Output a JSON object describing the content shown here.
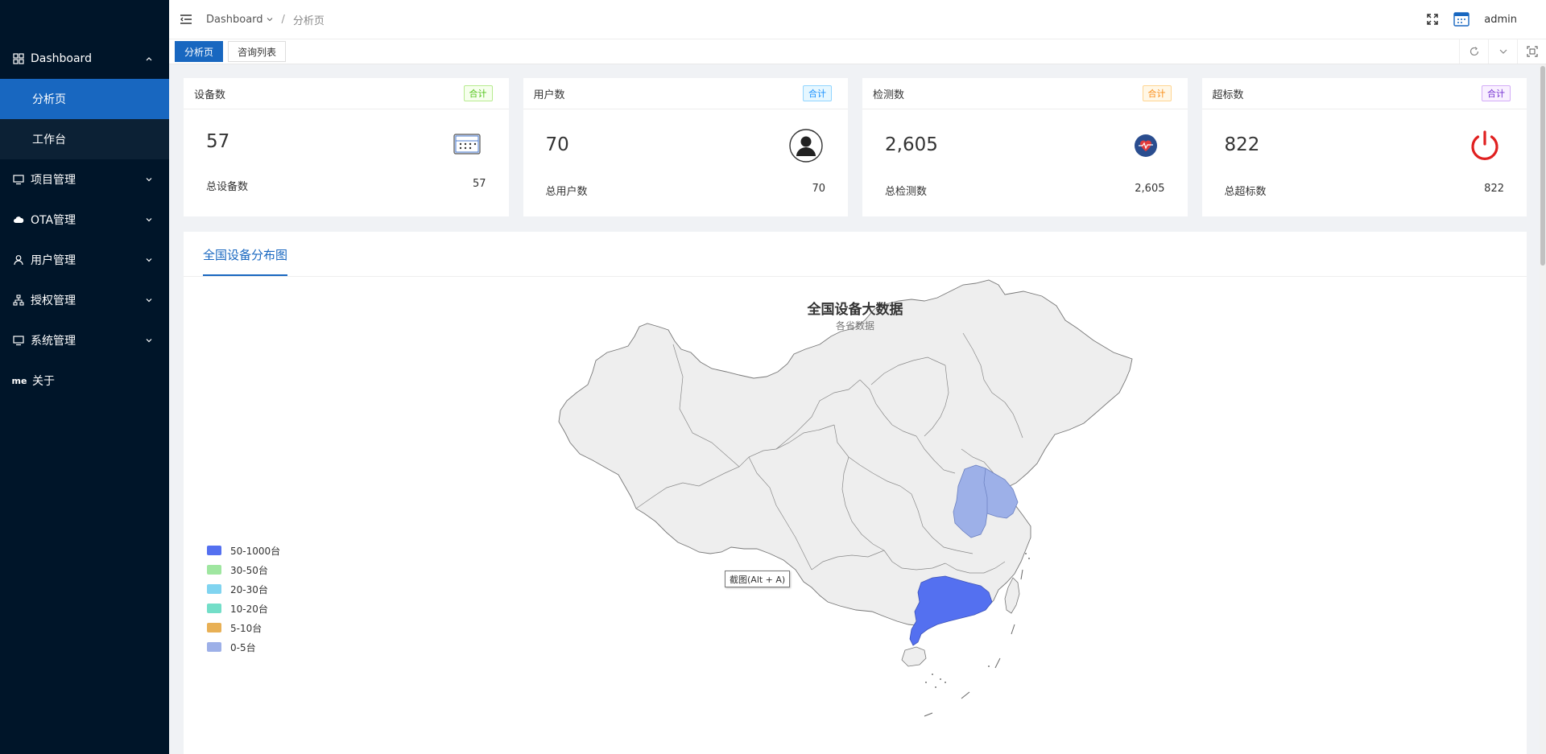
{
  "sidebar": {
    "items": [
      {
        "label": "Dashboard",
        "icon": "dashboard-grid-icon",
        "expanded": true,
        "children": [
          {
            "label": "分析页",
            "active": true
          },
          {
            "label": "工作台",
            "active": false
          }
        ]
      },
      {
        "label": "项目管理",
        "icon": "monitor-icon"
      },
      {
        "label": "OTA管理",
        "icon": "cloud-icon"
      },
      {
        "label": "用户管理",
        "icon": "user-icon"
      },
      {
        "label": "授权管理",
        "icon": "hierarchy-icon"
      },
      {
        "label": "系统管理",
        "icon": "monitor-icon"
      },
      {
        "label": "关于",
        "icon_text": "me"
      }
    ]
  },
  "header": {
    "breadcrumb": [
      "Dashboard",
      "分析页"
    ],
    "breadcrumb_separator": "/",
    "username": "admin"
  },
  "tabs": [
    {
      "label": "分析页",
      "active": true
    },
    {
      "label": "咨询列表",
      "active": false
    }
  ],
  "cards": [
    {
      "title": "设备数",
      "tag": "合计",
      "tag_color": "green",
      "value": "57",
      "footer_label": "总设备数",
      "footer_value": "57",
      "icon": "device-panel-icon"
    },
    {
      "title": "用户数",
      "tag": "合计",
      "tag_color": "blue",
      "value": "70",
      "footer_label": "总用户数",
      "footer_value": "70",
      "icon": "user-avatar-icon"
    },
    {
      "title": "检测数",
      "tag": "合计",
      "tag_color": "orange",
      "value": "2,605",
      "footer_label": "总检测数",
      "footer_value": "2,605",
      "icon": "heartbeat-icon"
    },
    {
      "title": "超标数",
      "tag": "合计",
      "tag_color": "purple",
      "value": "822",
      "footer_label": "总超标数",
      "footer_value": "822",
      "icon": "power-icon"
    }
  ],
  "panel": {
    "tab": "全国设备分布图",
    "map_title": "全国设备大数据",
    "map_subtitle": "各省数据",
    "legend": [
      {
        "label": "50-1000台",
        "color": "#5470f0"
      },
      {
        "label": "30-50台",
        "color": "#9fe6a0"
      },
      {
        "label": "20-30台",
        "color": "#80d4f0"
      },
      {
        "label": "10-20台",
        "color": "#73dec8"
      },
      {
        "label": "5-10台",
        "color": "#e8b055"
      },
      {
        "label": "0-5台",
        "color": "#9db0e8"
      }
    ],
    "tooltip": "截图(Alt + A)",
    "highlighted_regions": [
      {
        "name": "广东",
        "color": "#5470f0"
      },
      {
        "name": "江苏/安徽",
        "color": "#9db0e8"
      }
    ]
  },
  "colors": {
    "sidebar_bg": "#001529",
    "accent": "#1867c0",
    "map_fill": "#eeeeee",
    "map_stroke": "#777777"
  }
}
